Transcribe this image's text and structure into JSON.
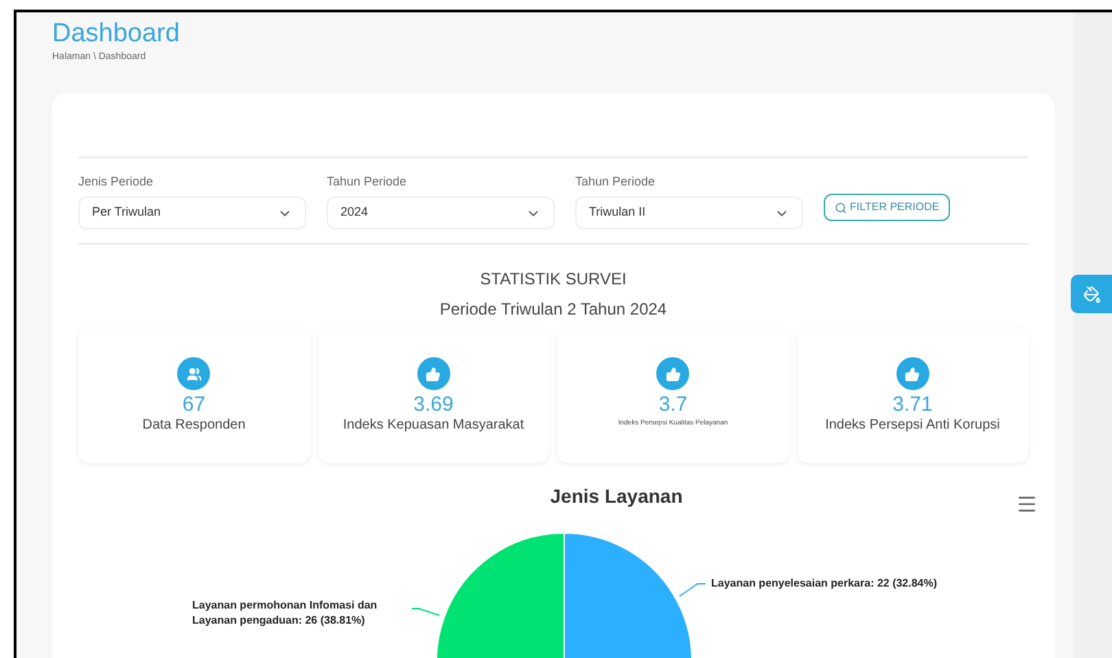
{
  "header": {
    "title": "Dashboard",
    "breadcrumb": "Halaman \\ Dashboard"
  },
  "filters": [
    {
      "label": "Jenis Periode",
      "value": "Per Triwulan"
    },
    {
      "label": "Tahun Periode",
      "value": "2024"
    },
    {
      "label": "Tahun Periode",
      "value": "Triwulan II"
    }
  ],
  "filter_button": "FILTER PERIODE",
  "stats_title": "STATISTIK SURVEI",
  "stats_subtitle": "Periode Triwulan 2 Tahun 2024",
  "stats": [
    {
      "kind": "people",
      "value": "67",
      "label": "Data Responden"
    },
    {
      "kind": "thumb",
      "value": "3.69",
      "label": "Indeks Kepuasan Masyarakat"
    },
    {
      "kind": "thumb",
      "value": "3.7",
      "label": "Indeks Persepsi Kualitas Pelayanan",
      "small": true
    },
    {
      "kind": "thumb",
      "value": "3.71",
      "label": "Indeks Persepsi Anti Korupsi"
    }
  ],
  "chart": {
    "title": "Jenis Layanan",
    "slices": [
      {
        "label": "Layanan penyelesaian perkara: 22 (32.84%)",
        "color": "#2caffe"
      },
      {
        "label": "Layanan permohonan Infomasi dan Layanan pengaduan: 26 (38.81%)",
        "color": "#00e272"
      }
    ]
  }
}
